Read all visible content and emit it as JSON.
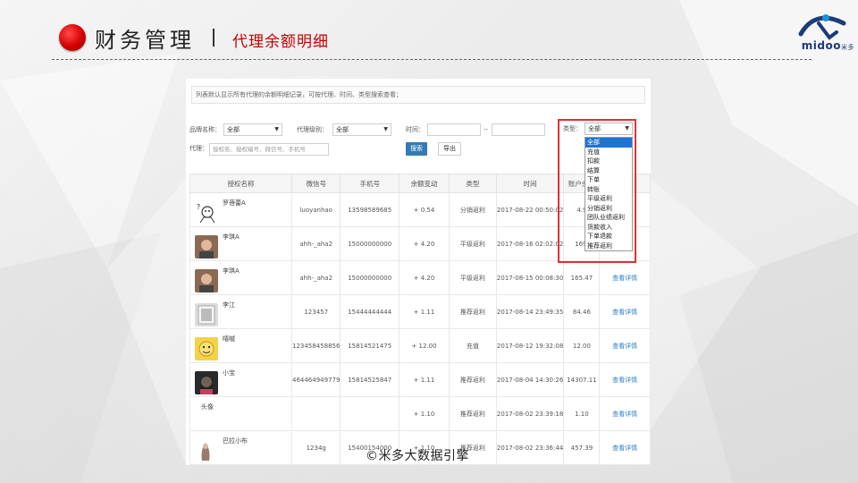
{
  "header": {
    "title": "财务管理",
    "subtitle": "代理余额明细"
  },
  "logo": {
    "text": "midoo",
    "small": "米多"
  },
  "notice": "列表默认显示所有代理的余额明细记录，可按代理、时间、类型搜索查看；",
  "filters": {
    "brand_label": "品牌名称：",
    "brand_value": "全部",
    "level_label": "代理级别：",
    "level_value": "全部",
    "time_label": "时间：",
    "time_sep": "--",
    "agent_label": "代理：",
    "agent_placeholder": "授权名、授权编号、微信号、手机号",
    "search_btn": "搜索",
    "export_btn": "导出",
    "type_label": "类型：",
    "type_value": "全部",
    "type_options": [
      "全部",
      "充值",
      "扣款",
      "结算",
      "下单",
      "转账",
      "平级返利",
      "分销返利",
      "团队业绩返利",
      "货款收入",
      "下单退款",
      "推荐返利"
    ]
  },
  "table": {
    "headers": [
      "授权名称",
      "微信号",
      "手机号",
      "余额变动",
      "类型",
      "时间",
      "账户余额",
      "操作"
    ],
    "rows": [
      {
        "name": "罗蓓蕾A",
        "wechat": "luoyanhao",
        "phone": "13598589685",
        "change": "+ 0.54",
        "type": "分销返利",
        "time": "2017-08-22 00:50:02",
        "balance": "4.9",
        "action": ""
      },
      {
        "name": "李琪A",
        "wechat": "ahh-_aha2",
        "phone": "15000000000",
        "change": "+ 4.20",
        "type": "平级返利",
        "time": "2017-08-16 02:02:02",
        "balance": "169.",
        "action": ""
      },
      {
        "name": "李琪A",
        "wechat": "ahh-_aha2",
        "phone": "15000000000",
        "change": "+ 4.20",
        "type": "平级返利",
        "time": "2017-08-15 00:08:30",
        "balance": "165.47",
        "action": "查看详情"
      },
      {
        "name": "李江",
        "wechat": "123457",
        "phone": "15444444444",
        "change": "+ 1.11",
        "type": "推荐返利",
        "time": "2017-08-14 23:49:35",
        "balance": "84.46",
        "action": "查看详情"
      },
      {
        "name": "嘻嘁",
        "wechat": "123458458856",
        "phone": "15814521475",
        "change": "+ 12.00",
        "type": "充值",
        "time": "2017-08-12 19:32:08",
        "balance": "12.00",
        "action": "查看详情"
      },
      {
        "name": "小宝",
        "wechat": "464464949779",
        "phone": "15814525847",
        "change": "+ 1.11",
        "type": "推荐返利",
        "time": "2017-08-04 14:30:26",
        "balance": "14307.11",
        "action": "查看详情"
      },
      {
        "name": "头像",
        "wechat": "",
        "phone": "",
        "change": "+ 1.10",
        "type": "推荐返利",
        "time": "2017-08-02 23:39:18",
        "balance": "1.10",
        "action": "查看详情"
      },
      {
        "name": "巴拉小布",
        "wechat": "1234g",
        "phone": "15400154000",
        "change": "+ 1.10",
        "type": "推荐返利",
        "time": "2017-08-02 23:36:44",
        "balance": "457.39",
        "action": "查看详情"
      }
    ]
  },
  "watermark": "©米多大数据引擎",
  "colors": {
    "accent": "#c00000",
    "primary_btn": "#337ab7",
    "highlight": "#e03030",
    "link": "#2b7fc6"
  }
}
